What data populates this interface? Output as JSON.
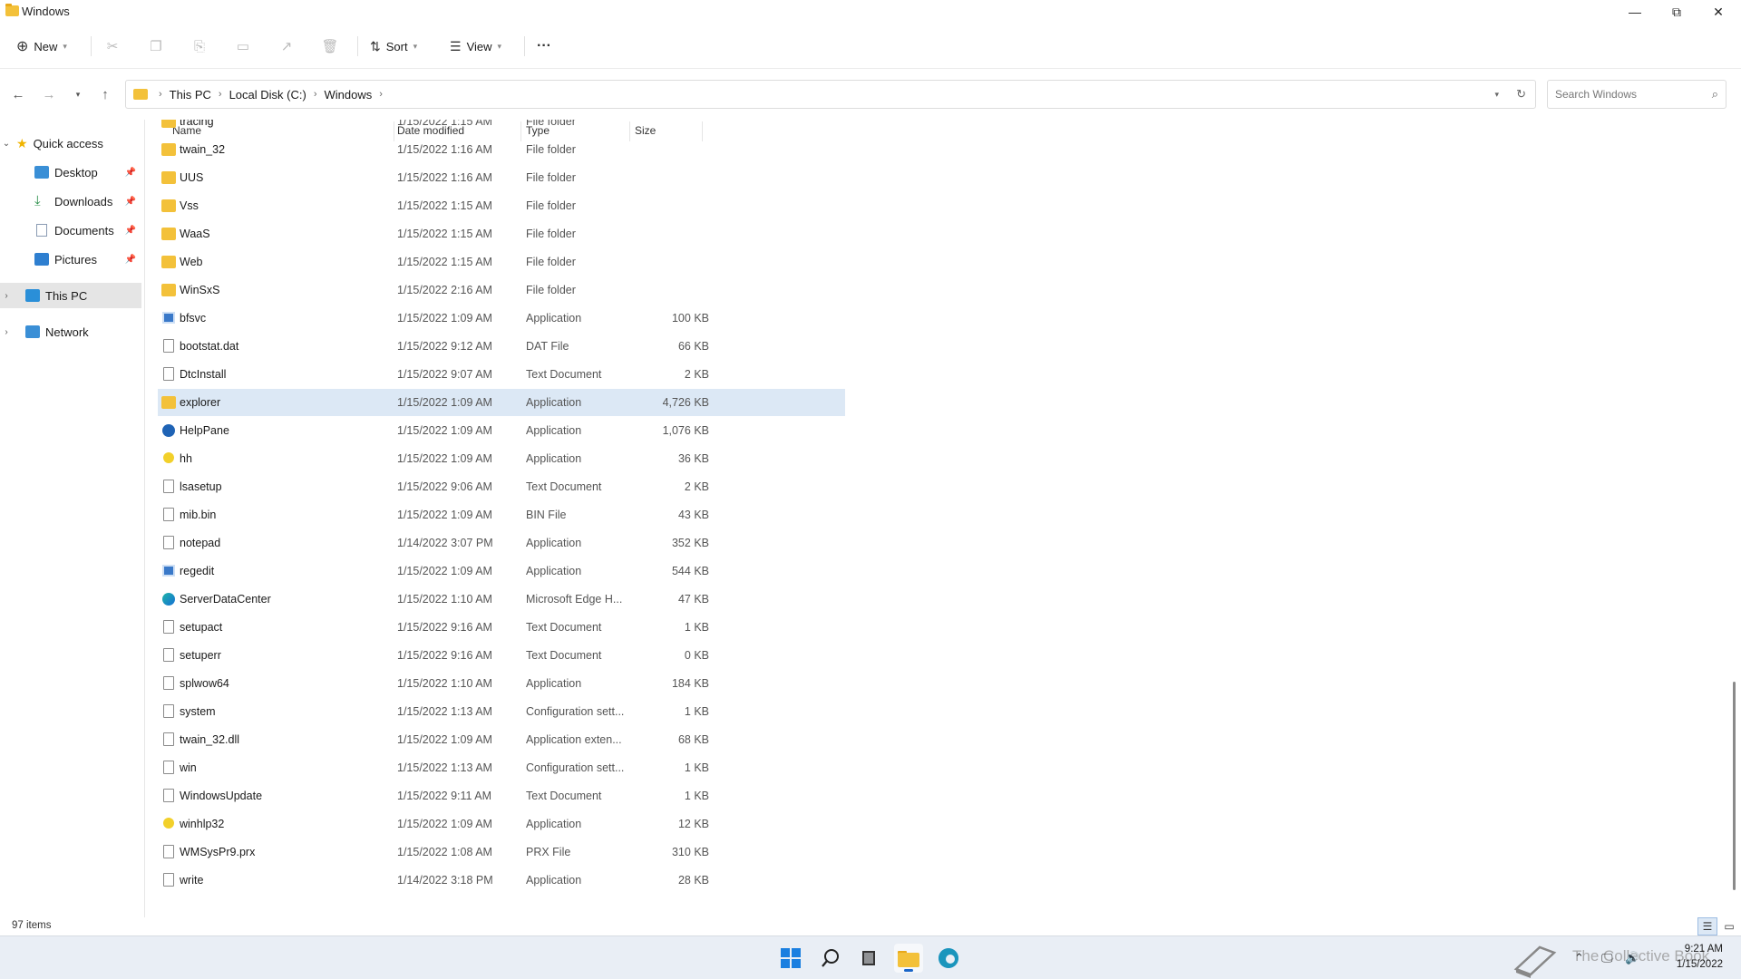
{
  "window": {
    "title": "Windows"
  },
  "toolbar": {
    "new_label": "New",
    "sort_label": "Sort",
    "view_label": "View",
    "more_label": "···"
  },
  "address": {
    "crumbs": [
      "This PC",
      "Local Disk (C:)",
      "Windows"
    ],
    "search_placeholder": "Search Windows"
  },
  "nav": {
    "quick_access": "Quick access",
    "items": [
      {
        "label": "Desktop",
        "color": "#3a8fd6"
      },
      {
        "label": "Downloads",
        "color": "#2a8f4a"
      },
      {
        "label": "Documents",
        "color": "#8a9bb3"
      },
      {
        "label": "Pictures",
        "color": "#2e7fd0"
      }
    ],
    "this_pc": "This PC",
    "network": "Network"
  },
  "columns": {
    "name": "Name",
    "date": "Date modified",
    "type": "Type",
    "size": "Size"
  },
  "files": [
    {
      "name": "tracing",
      "date": "1/15/2022 1:15 AM",
      "type": "File folder",
      "size": "",
      "icon": "folder-icon"
    },
    {
      "name": "twain_32",
      "date": "1/15/2022 1:16 AM",
      "type": "File folder",
      "size": "",
      "icon": "folder-icon"
    },
    {
      "name": "UUS",
      "date": "1/15/2022 1:16 AM",
      "type": "File folder",
      "size": "",
      "icon": "folder-icon"
    },
    {
      "name": "Vss",
      "date": "1/15/2022 1:15 AM",
      "type": "File folder",
      "size": "",
      "icon": "folder-icon"
    },
    {
      "name": "WaaS",
      "date": "1/15/2022 1:15 AM",
      "type": "File folder",
      "size": "",
      "icon": "folder-icon"
    },
    {
      "name": "Web",
      "date": "1/15/2022 1:15 AM",
      "type": "File folder",
      "size": "",
      "icon": "folder-icon"
    },
    {
      "name": "WinSxS",
      "date": "1/15/2022 2:16 AM",
      "type": "File folder",
      "size": "",
      "icon": "folder-icon"
    },
    {
      "name": "bfsvc",
      "date": "1/15/2022 1:09 AM",
      "type": "Application",
      "size": "100 KB",
      "icon": "app-icon"
    },
    {
      "name": "bootstat.dat",
      "date": "1/15/2022 9:12 AM",
      "type": "DAT File",
      "size": "66 KB",
      "icon": "document-icon"
    },
    {
      "name": "DtcInstall",
      "date": "1/15/2022 9:07 AM",
      "type": "Text Document",
      "size": "2 KB",
      "icon": "document-icon"
    },
    {
      "name": "explorer",
      "date": "1/15/2022 1:09 AM",
      "type": "Application",
      "size": "4,726 KB",
      "icon": "folder-icon",
      "selected": true
    },
    {
      "name": "HelpPane",
      "date": "1/15/2022 1:09 AM",
      "type": "Application",
      "size": "1,076 KB",
      "icon": "help-icon"
    },
    {
      "name": "hh",
      "date": "1/15/2022 1:09 AM",
      "type": "Application",
      "size": "36 KB",
      "icon": "yellow-help-icon"
    },
    {
      "name": "lsasetup",
      "date": "1/15/2022 9:06 AM",
      "type": "Text Document",
      "size": "2 KB",
      "icon": "document-icon"
    },
    {
      "name": "mib.bin",
      "date": "1/15/2022 1:09 AM",
      "type": "BIN File",
      "size": "43 KB",
      "icon": "document-icon"
    },
    {
      "name": "notepad",
      "date": "1/14/2022 3:07 PM",
      "type": "Application",
      "size": "352 KB",
      "icon": "notepad-icon"
    },
    {
      "name": "regedit",
      "date": "1/15/2022 1:09 AM",
      "type": "Application",
      "size": "544 KB",
      "icon": "regedit-icon"
    },
    {
      "name": "ServerDataCenter",
      "date": "1/15/2022 1:10 AM",
      "type": "Microsoft Edge H...",
      "size": "47 KB",
      "icon": "edge-icon"
    },
    {
      "name": "setupact",
      "date": "1/15/2022 9:16 AM",
      "type": "Text Document",
      "size": "1 KB",
      "icon": "document-icon"
    },
    {
      "name": "setuperr",
      "date": "1/15/2022 9:16 AM",
      "type": "Text Document",
      "size": "0 KB",
      "icon": "document-icon"
    },
    {
      "name": "splwow64",
      "date": "1/15/2022 1:10 AM",
      "type": "Application",
      "size": "184 KB",
      "icon": "printer-icon"
    },
    {
      "name": "system",
      "date": "1/15/2022 1:13 AM",
      "type": "Configuration sett...",
      "size": "1 KB",
      "icon": "config-icon"
    },
    {
      "name": "twain_32.dll",
      "date": "1/15/2022 1:09 AM",
      "type": "Application exten...",
      "size": "68 KB",
      "icon": "dll-icon"
    },
    {
      "name": "win",
      "date": "1/15/2022 1:13 AM",
      "type": "Configuration sett...",
      "size": "1 KB",
      "icon": "config-icon"
    },
    {
      "name": "WindowsUpdate",
      "date": "1/15/2022 9:11 AM",
      "type": "Text Document",
      "size": "1 KB",
      "icon": "document-icon"
    },
    {
      "name": "winhlp32",
      "date": "1/15/2022 1:09 AM",
      "type": "Application",
      "size": "12 KB",
      "icon": "yellow-help-icon"
    },
    {
      "name": "WMSysPr9.prx",
      "date": "1/15/2022 1:08 AM",
      "type": "PRX File",
      "size": "310 KB",
      "icon": "document-icon"
    },
    {
      "name": "write",
      "date": "1/14/2022 3:18 PM",
      "type": "Application",
      "size": "28 KB",
      "icon": "write-icon"
    }
  ],
  "status": {
    "count": "97 items"
  },
  "taskbar": {
    "time": "9:21 AM",
    "date": "1/15/2022",
    "watermark": "The Collective Book"
  },
  "colors": {
    "folder": "#f3c13a",
    "selection": "#dce8f5",
    "accent": "#1a66c9"
  }
}
